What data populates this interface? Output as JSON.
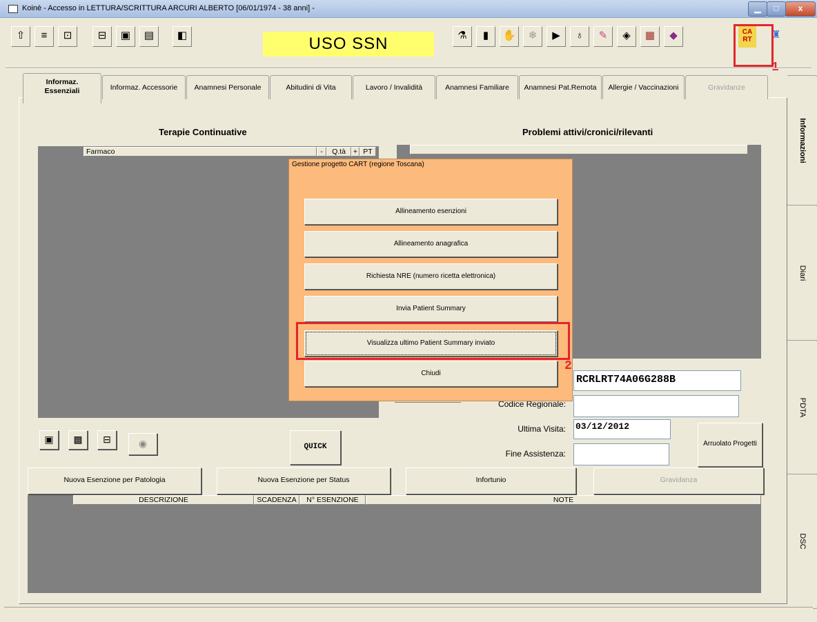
{
  "window": {
    "title": "Koinè - Accesso in LETTURA/SCRITTURA  ARCURI ALBERTO [06/01/1974 - 38 anni] -",
    "min": "▁",
    "max": "□",
    "close": "x"
  },
  "toolbar": {
    "uso_label": "USO SSN",
    "cart_label": "CA\nRT",
    "left_icons": [
      "up-arrow-icon",
      "list-icon",
      "export-icon",
      "print-drawer-icon",
      "save-disk-icon",
      "document-icon",
      "database-icon"
    ],
    "right_icons": [
      "pills-icon",
      "bottles-icon",
      "handshake-icon",
      "snowflake-icon",
      "monitor-icon",
      "stethoscope-icon",
      "injection-icon",
      "eye-icon",
      "gift-icon",
      "book-icon",
      "cart-icon",
      "extra-icon"
    ]
  },
  "annotations": {
    "badge1": "1",
    "badge2": "2"
  },
  "tabs": [
    {
      "label": "Informaz.\nEssenziali",
      "active": true
    },
    {
      "label": "Informaz. Accessorie"
    },
    {
      "label": "Anamnesi Personale"
    },
    {
      "label": "Abitudini di Vita"
    },
    {
      "label": "Lavoro / Invalidità"
    },
    {
      "label": "Anamnesi Familiare"
    },
    {
      "label": "Anamnesi Pat.Remota"
    },
    {
      "label": "Allergie / Vaccinazioni"
    },
    {
      "label": "Gravidanze",
      "disabled": true
    }
  ],
  "side_tabs": [
    "Informazioni",
    "Diari",
    "PDTA",
    "DSC"
  ],
  "terapie": {
    "heading": "Terapie Continuative",
    "col_farmaco": "Farmaco",
    "col_minus": "-",
    "col_qta": "Q.tà",
    "col_plus": "+",
    "col_pt": "PT"
  },
  "problemi": {
    "heading": "Problemi attivi/cronici/rilevanti"
  },
  "fields": {
    "codice_fiscale_value": "RCRLRT74A06G288B",
    "codice_regionale_label": "Codice Regionale:",
    "codice_regionale_value": "",
    "ultima_visita_label": "Ultima Visita:",
    "ultima_visita_value": "03/12/2012",
    "fine_assistenza_label": "Fine Assistenza:",
    "fine_assistenza_value": ""
  },
  "buttons": {
    "quick": "QUICK",
    "arruolato": "Arruolato Progetti",
    "nuova_patologia": "Nuova Esenzione per Patologia",
    "nuova_status": "Nuova Esenzione per Status",
    "infortunio": "Infortunio",
    "gravidanza": "Gravidanza"
  },
  "esenzioni_table": {
    "columns": [
      "DESCRIZIONE",
      "SCADENZA",
      "N° ESENZIONE",
      "NOTE"
    ]
  },
  "dialog": {
    "title": "Gestione progetto CART (regione Toscana)",
    "buttons": [
      "Allineamento esenzioni",
      "Allineamento anagrafica",
      "Richiesta NRE (numero ricetta elettronica)",
      "Invia Patient Summary",
      "Visualizza ultimo Patient Summary inviato",
      "Chiudi"
    ]
  }
}
